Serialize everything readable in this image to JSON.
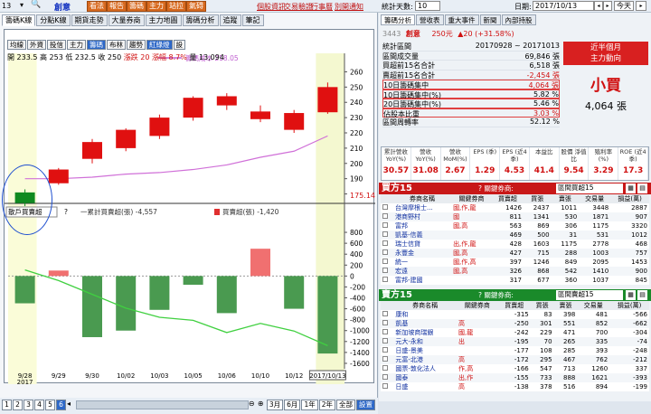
{
  "topbar": {
    "code": "13",
    "name": "創意",
    "buttons": [
      "看法",
      "報告",
      "籌碼",
      "主力",
      "站拉",
      "氣碍"
    ],
    "links": [
      "個股資訊",
      "交易驗證",
      "行事曆",
      "別開通知"
    ]
  },
  "tabs": [
    "籌碼K線",
    "分點K線",
    "期貨走勢",
    "大量券商",
    "主力地圖",
    "籌碼分析",
    "追蹤",
    "筆記"
  ],
  "chart_buttons": [
    "均線",
    "外資",
    "投信",
    "主力",
    "籌碼",
    "布林",
    "趨勢",
    "紅綠燈",
    "設"
  ],
  "ohlc": {
    "open": "開 233.5",
    "high": "高 253",
    "low": "低 232.5",
    "close": "收 250",
    "change": "漲跌 20",
    "pct": "漲幅 8.7%",
    "vol": "量 13,094"
  },
  "legend_top": "籌碼成本 218.05",
  "price_badge": "175.14",
  "lower_select": "散戶買賣超",
  "lower_legend": {
    "line": "一累計買賣超(張) -4,557",
    "bar": "買賣超(張) -1,420"
  },
  "date_badge": "2017/10/13",
  "year_label": "2017",
  "chart_data": {
    "type": "bar",
    "categories": [
      "9/28",
      "9/29",
      "9/30",
      "10/02",
      "10/03",
      "10/05",
      "10/06",
      "10/10",
      "10/12",
      "10/13"
    ],
    "candles": [
      {
        "o": 181,
        "c": 174,
        "h": 183,
        "l": 172
      },
      {
        "o": 187,
        "c": 196,
        "h": 197,
        "l": 186
      },
      {
        "o": 203,
        "c": 214,
        "h": 216,
        "l": 200
      },
      {
        "o": 210,
        "c": 222,
        "h": 223,
        "l": 208
      },
      {
        "o": 218,
        "c": 230,
        "h": 232,
        "l": 216
      },
      {
        "o": 230,
        "c": 243,
        "h": 244,
        "l": 228
      },
      {
        "o": 238,
        "c": 244,
        "h": 246,
        "l": 235
      },
      {
        "o": 229,
        "c": 234,
        "h": 238,
        "l": 227
      },
      {
        "o": 222,
        "c": 233,
        "h": 235,
        "l": 220
      },
      {
        "o": 233.5,
        "c": 250,
        "h": 253,
        "l": 232.5
      }
    ],
    "cost_line": [
      190,
      190,
      191,
      193,
      194,
      196,
      199,
      204,
      208,
      218
    ],
    "price_ylim": [
      175,
      265
    ],
    "price_ticks": [
      180,
      190,
      200,
      210,
      220,
      230,
      240,
      250,
      260
    ],
    "netflow": [
      -500,
      100,
      -1120,
      -1000,
      -620,
      -160,
      -680,
      500,
      -600,
      -1420
    ],
    "cumulative": [
      400,
      -300,
      -1200,
      -2100,
      -2700,
      -2900,
      -3700,
      -3100,
      -3600,
      -4557
    ],
    "flow_ticks": [
      800,
      600,
      400,
      200,
      0,
      -200,
      -400,
      -600,
      -800,
      -1000,
      -1200,
      -1400,
      -1600
    ],
    "flow_ylim": [
      -1700,
      900
    ]
  },
  "right": {
    "days_label": "統計天數:",
    "days_value": "10",
    "date_label": "日期:",
    "date_value": "2017/10/13",
    "today_btn": "今天",
    "tabs": [
      "籌碼分析",
      "營收表",
      "重大事件",
      "新聞",
      "內部持股"
    ],
    "stock": {
      "code": "3443",
      "name": "創意",
      "price": "250元",
      "chg": "▲20 (+31.58%)"
    },
    "stats": [
      {
        "k": "統計區間",
        "v": "20170928 ~ 20171013"
      },
      {
        "k": "區間成交量",
        "v": "69,846 張"
      },
      {
        "k": "買超前15名合計",
        "v": "6,518 張"
      },
      {
        "k": "賣超前15名合計",
        "v": "-2,454 張"
      },
      {
        "k": "10日籌碼集中",
        "v": "4,064 張"
      },
      {
        "k": "10日籌碼集中(%)",
        "v": "5.82 %"
      },
      {
        "k": "20日籌碼集中(%)",
        "v": "5.46 %"
      },
      {
        "k": "佔股本比重",
        "v": "3.03 %"
      },
      {
        "k": "區間周轉率",
        "v": "52.12 %"
      }
    ],
    "signal": {
      "l1": "近半個月",
      "l2": "主力動向",
      "big": "小買",
      "amount": "4,064 張"
    },
    "metrics": [
      {
        "h": "累計營收 YoY(%)",
        "v": "30.57"
      },
      {
        "h": "營收 YoY(%)",
        "v": "31.08"
      },
      {
        "h": "營收 MoM(%)",
        "v": "2.67"
      },
      {
        "h": "EPS (季)",
        "v": "1.29"
      },
      {
        "h": "EPS (近4季)",
        "v": "4.53"
      },
      {
        "h": "本益比",
        "v": "41.4"
      },
      {
        "h": "股價 淨值比",
        "v": "9.54"
      },
      {
        "h": "殖利率 (%)",
        "v": "3.29"
      },
      {
        "h": "ROE (近4季)",
        "v": "17.3"
      }
    ],
    "buy": {
      "title": "買方15",
      "sub": "? 關鍵券商:",
      "select": "區間買超15",
      "headers": [
        "",
        "券商名稱",
        "關鍵券商",
        "買賣超",
        "買張",
        "賣張",
        "交易量",
        "損益(萬)"
      ],
      "rows": [
        [
          "台灣摩根士...",
          "國,作,龍",
          "1426",
          "2437",
          "1011",
          "3448",
          "2887"
        ],
        [
          "港商野村",
          "國",
          "811",
          "1341",
          "530",
          "1871",
          "907"
        ],
        [
          "富邦",
          "國,高",
          "563",
          "869",
          "306",
          "1175",
          "3320"
        ],
        [
          "凱基-信義",
          "",
          "469",
          "500",
          "31",
          "531",
          "1012"
        ],
        [
          "瑞士信貸",
          "出,作,龍",
          "428",
          "1603",
          "1175",
          "2778",
          "468"
        ],
        [
          "永豐金",
          "國,高",
          "427",
          "715",
          "288",
          "1003",
          "757"
        ],
        [
          "統一",
          "國,作,高",
          "397",
          "1246",
          "849",
          "2095",
          "1453"
        ],
        [
          "宏遠",
          "國,高",
          "326",
          "868",
          "542",
          "1410",
          "900"
        ],
        [
          "富邦-建國",
          "",
          "317",
          "677",
          "360",
          "1037",
          "845"
        ]
      ]
    },
    "sell": {
      "title": "賣方15",
      "sub": "? 關鍵券商:",
      "select": "區間賣超15",
      "headers": [
        "",
        "券商名稱",
        "關鍵券商",
        "買賣超",
        "買張",
        "賣張",
        "交易量",
        "損益(萬)"
      ],
      "rows": [
        [
          "康和",
          "",
          "-315",
          "83",
          "398",
          "481",
          "-566"
        ],
        [
          "凱基",
          "高",
          "-250",
          "301",
          "551",
          "852",
          "-662"
        ],
        [
          "新加坡商瑞銀",
          "國,龍",
          "-242",
          "229",
          "471",
          "700",
          "-304"
        ],
        [
          "元大-永和",
          "出",
          "-195",
          "70",
          "265",
          "335",
          "-74"
        ],
        [
          "日盛-景美",
          "",
          "-177",
          "108",
          "285",
          "393",
          "-248"
        ],
        [
          "元富-北港",
          "高",
          "-172",
          "295",
          "467",
          "762",
          "-212"
        ],
        [
          "國票-敦化法人",
          "作,高",
          "-166",
          "547",
          "713",
          "1260",
          "337"
        ],
        [
          "國泰",
          "出,作",
          "-155",
          "733",
          "888",
          "1621",
          "-393"
        ],
        [
          "日盛",
          "高",
          "-138",
          "378",
          "516",
          "894",
          "-199"
        ]
      ]
    }
  },
  "pages": [
    "1",
    "2",
    "3",
    "4",
    "5",
    "6"
  ],
  "ranges": [
    "3月",
    "6月",
    "1年",
    "2年",
    "全部",
    "設置"
  ]
}
